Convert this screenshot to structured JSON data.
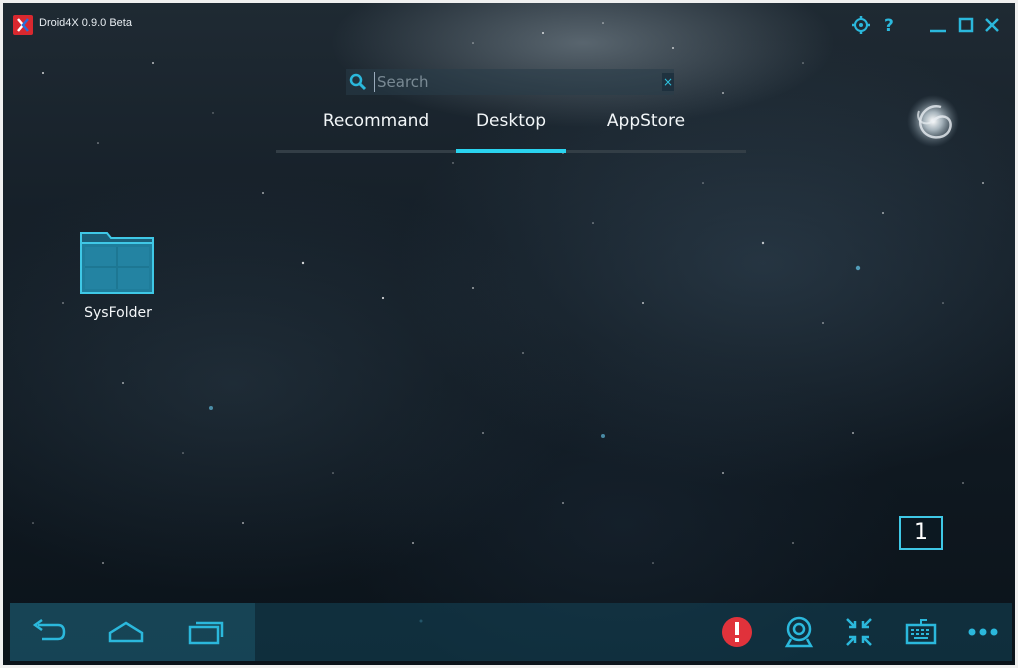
{
  "window": {
    "title": "Droid4X 0.9.0 Beta",
    "icons": [
      "settings-icon",
      "help-icon",
      "minimize-icon",
      "maximize-icon",
      "close-icon"
    ]
  },
  "search": {
    "placeholder": "Search",
    "value": "",
    "clear_symbol": "×"
  },
  "tabs": {
    "items": [
      "Recommand",
      "Desktop",
      "AppStore"
    ],
    "active": "Desktop"
  },
  "desktop": {
    "folder_label": "SysFolder",
    "page_number": "1"
  },
  "navbar": {
    "left_buttons": [
      "back-icon",
      "home-icon",
      "recent-apps-icon"
    ],
    "right_buttons": [
      "alert-icon",
      "webcam-icon",
      "shrink-icon",
      "keyboard-icon",
      "more-icon"
    ]
  },
  "colors": {
    "accent": "#2ad3ef",
    "alert": "#e0323b",
    "navbar": "#1a4a5a"
  }
}
